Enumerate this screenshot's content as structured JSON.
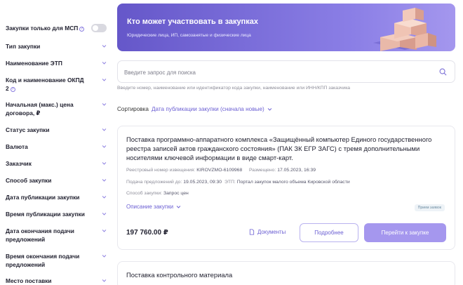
{
  "filters": {
    "msp_only": "Закупки только для МСП",
    "type": "Тип закупки",
    "etp": "Наименование ЭТП",
    "okpd": "Код и наименование ОКПД 2",
    "price": "Начальная (макс.) цена договора, ₽",
    "status": "Статус закупки",
    "currency": "Валюта",
    "customer": "Заказчик",
    "method": "Способ закупки",
    "pub_date": "Дата публикации закупки",
    "pub_time": "Время публикации закупки",
    "end_date": "Дата окончания подачи предложений",
    "end_time": "Время окончания подачи предложений",
    "place": "Место поставки"
  },
  "banner": {
    "title": "Кто может участвовать в закупках",
    "subtitle": "Юридические лица, ИП, самозанятые и физические лица"
  },
  "search": {
    "placeholder": "Введите запрос для поиска",
    "hint": "Введите номер, наименование или идентификатор кода закупки, наименование или ИНН/КПП заказчика"
  },
  "sort": {
    "label": "Сортировка",
    "value": "Дата публикации закупки (сначала новые)"
  },
  "card": {
    "title": "Поставка программно-аппаратного комплекса «Защищённый компьютер Единого государственного реестра записей актов гражданского состояния» (ПАК ЗК ЕГР ЗАГС) с тремя дополнительными носителями ключевой информации в виде смарт-карт.",
    "reg_label": "Реестровый номер извещения:",
    "reg_value": "KIROVZMO-6109968",
    "placed_label": "Размещено:",
    "placed_value": "17.05.2023, 16:39",
    "deadline_label": "Подача предложений до:",
    "deadline_value": "19.05.2023, 09:30",
    "etp_label": "ЭТП:",
    "etp_value": "Портал закупок малого объема Кировской области",
    "method_label": "Способ закупки:",
    "method_value": "Запрос цен",
    "desc_link": "Описание закупки",
    "badge": "Прием заявок",
    "price": "197 760.00 ₽",
    "docs": "Документы",
    "more": "Подробнее",
    "go": "Перейти к закупке"
  },
  "card2": {
    "title": "Поставка контрольного материала"
  },
  "colors": {
    "accent": "#6b5fd3",
    "button_primary": "#a597ee",
    "banner_start": "#6557c9",
    "banner_end": "#a497ee"
  }
}
